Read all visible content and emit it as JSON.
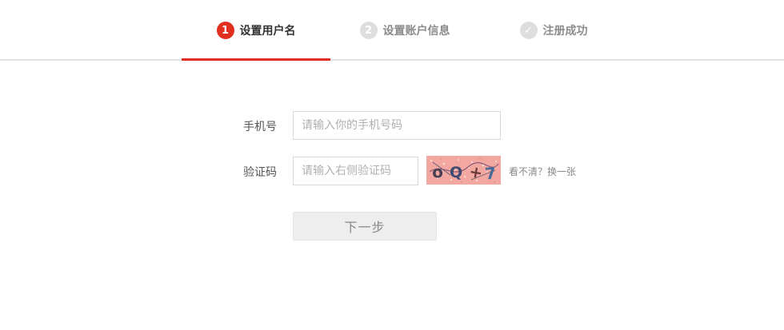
{
  "steps": [
    {
      "number": "1",
      "label": "设置用户名",
      "state": "active"
    },
    {
      "number": "2",
      "label": "设置账户信息",
      "state": "pending"
    },
    {
      "number": "✓",
      "label": "注册成功",
      "state": "pending"
    }
  ],
  "form": {
    "phone": {
      "label": "手机号",
      "placeholder": "请输入你的手机号码",
      "value": ""
    },
    "captcha": {
      "label": "验证码",
      "placeholder": "请输入右侧验证码",
      "value": "",
      "image_text": "oQ+7",
      "refresh_label": "看不清？换一张"
    },
    "next_label": "下一步"
  },
  "colors": {
    "accent": "#e02f1f",
    "step_inactive": "#dedede",
    "captcha_bg": "#f2a8a0",
    "button_bg": "#eeeeee"
  }
}
